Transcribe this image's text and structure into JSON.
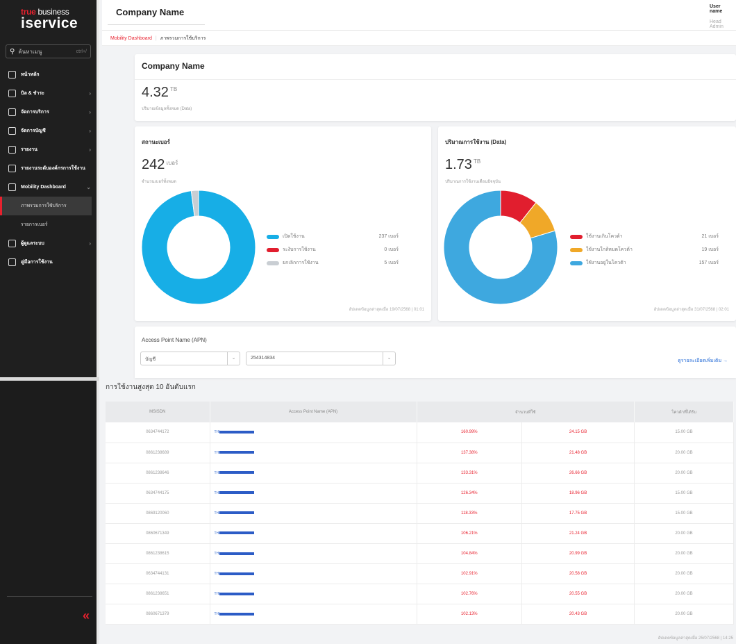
{
  "brand": {
    "line1_a": "true",
    "line1_b": "business",
    "line2": "iservice"
  },
  "search": {
    "placeholder": "ค้นหาเมนู",
    "shortcut": "ctrl+/"
  },
  "sidebar": {
    "items": [
      {
        "label": "หน้าหลัก",
        "type": "item",
        "chevron": ""
      },
      {
        "label": "บิล & ชำระ",
        "type": "item",
        "chevron": "›"
      },
      {
        "label": "จัดการบริการ",
        "type": "item",
        "chevron": "›"
      },
      {
        "label": "จัดการบัญชี",
        "type": "item",
        "chevron": "›"
      },
      {
        "label": "รายงาน",
        "type": "item",
        "chevron": "›"
      },
      {
        "label": "รายงานระดับองค์กรการใช้งาน",
        "type": "item",
        "chevron": ""
      },
      {
        "label": "Mobility Dashboard",
        "type": "item",
        "chevron": "⌄"
      },
      {
        "label": "ภาพรวมการใช้บริการ",
        "type": "sub",
        "active": true
      },
      {
        "label": "รายการเบอร์",
        "type": "sub",
        "active": false
      },
      {
        "label": "ผู้ดูแลระบบ",
        "type": "item",
        "chevron": "›"
      },
      {
        "label": "คู่มือการใช้งาน",
        "type": "item",
        "chevron": ""
      }
    ],
    "collapse": "«"
  },
  "header": {
    "company": "Company Name",
    "user_name": "User name",
    "user_role": "Head Admin"
  },
  "breadcrumb": {
    "root": "Mobility Dashboard",
    "current": "ภาพรวมการใช้บริการ"
  },
  "summary": {
    "title": "Company Name",
    "value": "4.32",
    "unit": "TB",
    "caption": "ปริมาณข้อมูลทั้งหมด (Data)"
  },
  "status_card": {
    "title": "สถานะเบอร์",
    "value": "242",
    "unit": "เบอร์",
    "caption": "จำนวนเบอร์ทั้งหมด",
    "updated": "อัปเดตข้อมูลล่าสุดเมื่อ 19/07/2568 | 01:01",
    "legend": [
      {
        "label": "เปิดใช้งาน",
        "value": "237 เบอร์",
        "color": "#17aee6"
      },
      {
        "label": "ระงับการใช้งาน",
        "value": "0 เบอร์",
        "color": "#e11e2e"
      },
      {
        "label": "ยกเลิกการใช้งาน",
        "value": "5 เบอร์",
        "color": "#c9ced3"
      }
    ]
  },
  "usage_card": {
    "title": "ปริมาณการใช้งาน (Data)",
    "value": "1.73",
    "unit": "TB",
    "caption": "ปริมาณการใช้งานเดือนปัจจุบัน",
    "updated": "อัปเดตข้อมูลล่าสุดเมื่อ 31/07/2568 | 02:01",
    "legend": [
      {
        "label": "ใช้งานเกินโควต้า",
        "value": "21 เบอร์",
        "color": "#e11e2e"
      },
      {
        "label": "ใช้งานใกล้หมดโควต้า",
        "value": "19 เบอร์",
        "color": "#f0a828"
      },
      {
        "label": "ใช้งานอยู่ในโควต้า",
        "value": "157 เบอร์",
        "color": "#3ea8df"
      }
    ]
  },
  "chart_data": [
    {
      "type": "pie",
      "title": "สถานะเบอร์",
      "categories": [
        "เปิดใช้งาน",
        "ระงับการใช้งาน",
        "ยกเลิกการใช้งาน"
      ],
      "values": [
        237,
        0,
        5
      ]
    },
    {
      "type": "pie",
      "title": "ปริมาณการใช้งาน (Data)",
      "categories": [
        "ใช้งานเกินโควต้า",
        "ใช้งานใกล้หมดโควต้า",
        "ใช้งานอยู่ในโควต้า"
      ],
      "values": [
        21,
        19,
        157
      ]
    }
  ],
  "apn": {
    "title": "Access Point Name (APN)",
    "select1": "บัญชี",
    "select2": "254314834",
    "link": "ดูรายละเอียดเพิ่มเติม →"
  },
  "table": {
    "title": "การใช้งานสูงสุด 10 อันดับแรก",
    "headers": [
      "MSISDN",
      "Access Point Name (APN)",
      "จำนวนที่ใช้",
      "โควต้าที่ได้รับ"
    ],
    "rows": [
      {
        "msisdn": "0634744172",
        "apn": "THI",
        "pct": "160.99%",
        "used": "24.15 GB",
        "quota": "15.00 GB"
      },
      {
        "msisdn": "0861238689",
        "apn": "THI",
        "pct": "137.38%",
        "used": "21.48 GB",
        "quota": "20.00 GB"
      },
      {
        "msisdn": "0861238646",
        "apn": "THI",
        "pct": "133.31%",
        "used": "26.66 GB",
        "quota": "20.00 GB"
      },
      {
        "msisdn": "0634744175",
        "apn": "THI",
        "pct": "126.34%",
        "used": "18.96 GB",
        "quota": "15.00 GB"
      },
      {
        "msisdn": "0869120060",
        "apn": "THI",
        "pct": "118.33%",
        "used": "17.75 GB",
        "quota": "15.00 GB"
      },
      {
        "msisdn": "0860671349",
        "apn": "THI",
        "pct": "106.21%",
        "used": "21.24 GB",
        "quota": "20.00 GB"
      },
      {
        "msisdn": "0861238615",
        "apn": "THI",
        "pct": "104.84%",
        "used": "20.99 GB",
        "quota": "20.00 GB"
      },
      {
        "msisdn": "0634744131",
        "apn": "THI",
        "pct": "102.91%",
        "used": "20.58 GB",
        "quota": "20.00 GB"
      },
      {
        "msisdn": "0861238651",
        "apn": "THI",
        "pct": "102.76%",
        "used": "20.55 GB",
        "quota": "20.00 GB"
      },
      {
        "msisdn": "0860671379",
        "apn": "THI",
        "pct": "102.13%",
        "used": "20.43 GB",
        "quota": "20.00 GB"
      }
    ],
    "updated": "อัปเดตข้อมูลล่าสุดเมื่อ 25/07/2568 | 14:25"
  }
}
